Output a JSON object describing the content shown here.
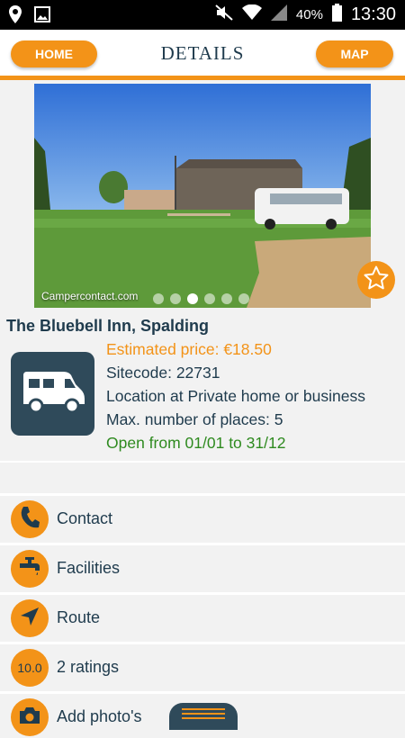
{
  "status_bar": {
    "battery_percent": "40%",
    "time": "13:30"
  },
  "header": {
    "home_label": "HOME",
    "title": "DETAILS",
    "map_label": "MAP"
  },
  "photo": {
    "watermark": "Campercontact.com",
    "slide_count": 6,
    "active_slide": 3
  },
  "site": {
    "name": "The Bluebell Inn, Spalding",
    "price": "Estimated price: €18.50",
    "sitecode": "Sitecode: 22731",
    "location": "Location at Private home or business",
    "max_places": "Max. number of places: 5",
    "open_period": "Open from 01/01 to 31/12"
  },
  "menu": {
    "contact": "Contact",
    "facilities": "Facilities",
    "route": "Route",
    "rating_value": "10.0",
    "ratings": "2 ratings",
    "add_photos": "Add photo's"
  },
  "colors": {
    "accent": "#f39318",
    "dark": "#2f4a5a",
    "text": "#1f3b4d",
    "open_green": "#2e8a1f"
  }
}
